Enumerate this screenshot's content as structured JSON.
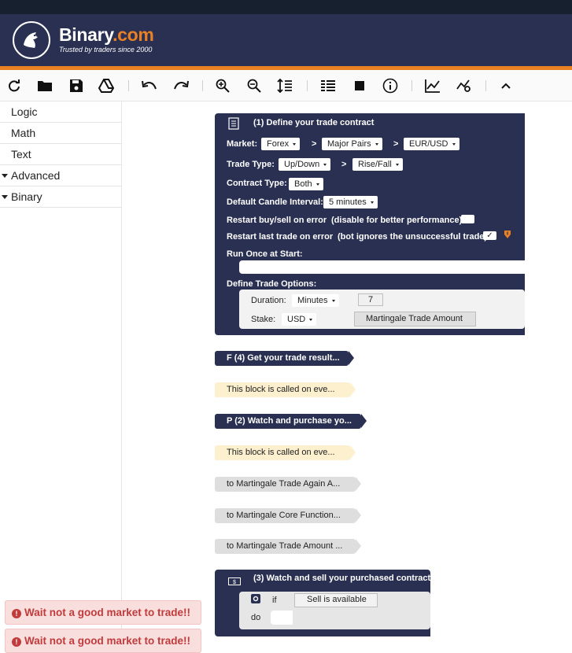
{
  "header": {
    "brand_main": "Binary",
    "brand_suffix": ".com",
    "tagline": "Trusted by traders since 2000",
    "colors": {
      "header_bg": "#2a3052",
      "accent": "#e98024",
      "top_strip": "#17202e"
    }
  },
  "toolbar": {
    "icons": [
      "reset-icon",
      "open-folder-icon",
      "save-icon",
      "google-drive-icon",
      "undo-icon",
      "redo-icon",
      "zoom-in-icon",
      "zoom-out-icon",
      "sort-icon",
      "summary-icon",
      "stop-icon",
      "info-icon",
      "chart-icon",
      "trading-view-icon",
      "collapse-icon"
    ]
  },
  "sidebar": {
    "items": [
      {
        "label": "Logic",
        "expandable": false
      },
      {
        "label": "Math",
        "expandable": false
      },
      {
        "label": "Text",
        "expandable": false
      },
      {
        "label": "Advanced",
        "expandable": true
      },
      {
        "label": "Binary",
        "expandable": true
      }
    ]
  },
  "alerts": [
    {
      "text": "Wait not a good market to trade!!"
    },
    {
      "text": "Wait not a good market to trade!!"
    }
  ],
  "trade_block": {
    "title": "(1) Define your trade contract",
    "market_label": "Market:",
    "market": "Forex",
    "submarket": "Major Pairs",
    "symbol": "EUR/USD",
    "gt": ">",
    "trade_type_label": "Trade Type:",
    "trade_type": "Up/Down",
    "trade_subtype": "Rise/Fall",
    "contract_type_label": "Contract Type:",
    "contract_type": "Both",
    "candle_label": "Default Candle Interval:",
    "candle_interval": "5 minutes",
    "restart_buysell_label": "Restart buy/sell on error",
    "restart_buysell_note": "(disable for better performance):",
    "restart_last_label": "Restart last trade on error",
    "restart_last_note": "(bot ignores the unsuccessful trade):",
    "restart_last_checked": "✓",
    "run_once_label": "Run Once at Start:",
    "define_options_label": "Define Trade Options:",
    "duration_label": "Duration:",
    "duration_unit": "Minutes",
    "duration_value": "7",
    "stake_label": "Stake:",
    "stake_currency": "USD",
    "stake_value": "Martingale Trade Amount"
  },
  "blocks": [
    {
      "label": "F (4) Get your trade result...",
      "style": "navy"
    },
    {
      "label": "This block is called on eve...",
      "style": "cream"
    },
    {
      "label": "P (2) Watch and purchase yo...",
      "style": "navy"
    },
    {
      "label": "This block is called on eve...",
      "style": "cream"
    },
    {
      "label": "to Martingale Trade Again A...",
      "style": "gray"
    },
    {
      "label": "to Martingale Core Function...",
      "style": "gray"
    },
    {
      "label": "to Martingale Trade Amount ...",
      "style": "gray"
    }
  ],
  "sell_block": {
    "title": "(3) Watch and sell your purchased contract",
    "if_label": "if",
    "condition": "Sell is available",
    "do_label": "do"
  }
}
